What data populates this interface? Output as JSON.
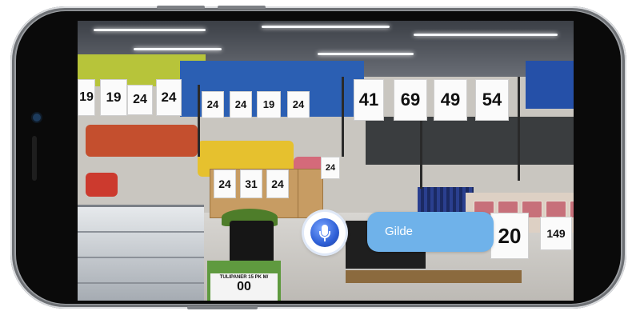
{
  "scene": {
    "type": "AR voice assistant overlay on live camera view of grocery store",
    "price_signs_top": [
      {
        "price": "19",
        "sup": "90"
      },
      {
        "price": "24",
        "sup": "90"
      },
      {
        "price": "24",
        "sup": "90"
      },
      {
        "price": "24",
        "sup": "90"
      },
      {
        "price": "24",
        "sup": "90"
      },
      {
        "price": "19",
        "sup": "90"
      },
      {
        "price": "24",
        "sup": "90"
      },
      {
        "price": "41",
        "sup": "90"
      },
      {
        "price": "69",
        "sup": "90"
      },
      {
        "price": "49",
        "sup": "90"
      },
      {
        "price": "54",
        "sup": "90"
      }
    ],
    "price_signs_crates": [
      {
        "price": "24",
        "sup": "90"
      },
      {
        "price": "31",
        "sup": "90"
      },
      {
        "price": "24",
        "sup": "90"
      },
      {
        "price": "24",
        "sup": "90"
      }
    ],
    "price_signs_right": [
      {
        "price": "20",
        "sup": "00"
      },
      {
        "price": "149",
        "sup": "90"
      }
    ],
    "tulip_label": "TULIPANER 15 PK M/",
    "tulip_price": "00"
  },
  "assistant": {
    "mic_icon": "microphone-icon",
    "speech_text": "Gilde"
  },
  "colors": {
    "bubble": "#6fb2ea",
    "mic_blue": "#2e5fd6",
    "frame": "#9c9fa3"
  }
}
